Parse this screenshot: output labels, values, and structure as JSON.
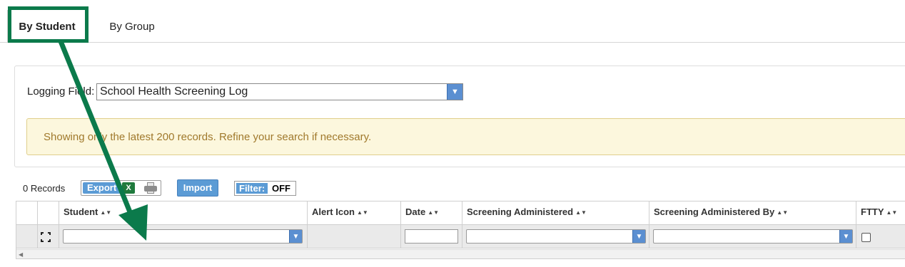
{
  "tabs": [
    {
      "label": "By Student",
      "active": true
    },
    {
      "label": "By Group",
      "active": false
    }
  ],
  "logging_field": {
    "label": "Logging Field:",
    "selected": "School Health Screening Log"
  },
  "notice": {
    "text": "Showing only the latest 200 records. Refine your search if necessary."
  },
  "toolbar": {
    "records": "0 Records",
    "export_label": "Export",
    "excel_icon": "X",
    "import_label": "Import",
    "filter_label": "Filter:",
    "filter_state": "OFF"
  },
  "grid": {
    "columns": [
      {
        "label": "Student",
        "sort_icon": "▲▼"
      },
      {
        "label": "Alert Icon",
        "sort_icon": "▲▼"
      },
      {
        "label": "Date",
        "sort_icon": "▲▼"
      },
      {
        "label": "Screening Administered",
        "sort_icon": "▲▼"
      },
      {
        "label": "Screening Administered By",
        "sort_icon": "▲▼"
      },
      {
        "label": "FTTY",
        "sort_icon": "▲▼"
      }
    ],
    "dropdown_arrow": "▼",
    "scroll_left": "◀"
  },
  "colors": {
    "annotation": "#0b7a4b",
    "button_blue": "#5b9bd5",
    "notice_bg": "#fcf7dd",
    "notice_text": "#a0792c"
  }
}
